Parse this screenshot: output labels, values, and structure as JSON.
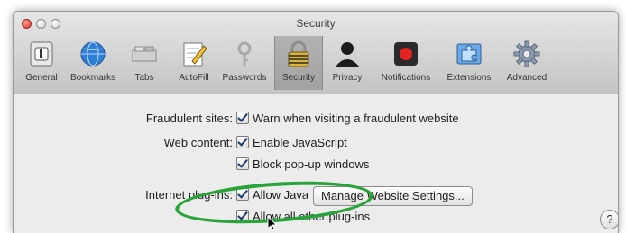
{
  "window": {
    "title": "Security"
  },
  "toolbar": {
    "items": [
      {
        "label": "General",
        "icon": "general-switch-icon"
      },
      {
        "label": "Bookmarks",
        "icon": "globe-icon"
      },
      {
        "label": "Tabs",
        "icon": "tabs-icon"
      },
      {
        "label": "AutoFill",
        "icon": "pencil-form-icon"
      },
      {
        "label": "Passwords",
        "icon": "key-icon"
      },
      {
        "label": "Security",
        "icon": "padlock-icon",
        "selected": true
      },
      {
        "label": "Privacy",
        "icon": "person-silhouette-icon"
      },
      {
        "label": "Notifications",
        "icon": "notification-record-icon"
      },
      {
        "label": "Extensions",
        "icon": "puzzle-icon"
      },
      {
        "label": "Advanced",
        "icon": "gear-icon"
      }
    ]
  },
  "security": {
    "fraudulent_label": "Fraudulent sites:",
    "fraudulent_checkbox": "Warn when visiting a fraudulent website",
    "webcontent_label": "Web content:",
    "javascript_checkbox": "Enable JavaScript",
    "popups_checkbox": "Block pop-up windows",
    "plugins_label": "Internet plug-ins:",
    "java_checkbox": "Allow Java",
    "manage_button": "Manage Website Settings...",
    "other_plugins_checkbox": "Allow all other plug-ins",
    "help_button": "?"
  },
  "checkbox_states": {
    "fraudulent": true,
    "javascript": true,
    "popups": true,
    "java": true,
    "other_plugins": true
  },
  "colors": {
    "annotation_ellipse": "#2aa43a",
    "checkmark": "#17386e"
  }
}
